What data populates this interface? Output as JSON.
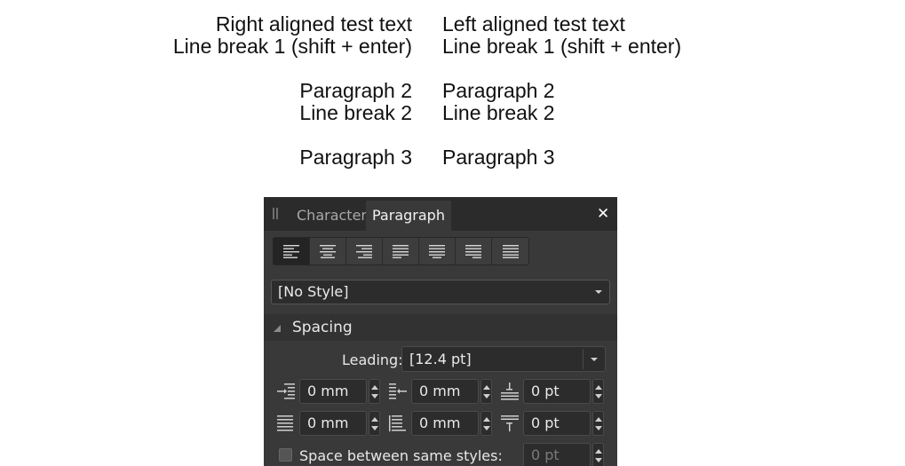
{
  "canvas": {
    "right_aligned": [
      "Right aligned test text",
      "Line break 1 (shift + enter)",
      "",
      "Paragraph 2",
      "Line break 2",
      "",
      "Paragraph 3"
    ],
    "left_aligned": [
      "Left aligned test text",
      "Line break 1 (shift + enter)",
      "",
      "Paragraph 2",
      "Line break 2",
      "",
      "Paragraph 3"
    ]
  },
  "panel": {
    "tabs": [
      "Character",
      "Paragraph"
    ],
    "active_tab": "Paragraph",
    "close_glyph": "✕",
    "alignment_buttons": [
      "align-left",
      "align-center",
      "align-right",
      "justify-left",
      "justify-center",
      "justify-right",
      "justify-all"
    ],
    "active_alignment": "align-left",
    "style_select": {
      "value": "[No Style]"
    },
    "spacing": {
      "title": "Spacing",
      "leading_label": "Leading:",
      "leading_value": "[12.4 pt]",
      "left_indent": "0 mm",
      "first_line_indent": "0 mm",
      "space_before": "0 pt",
      "right_indent": "0 mm",
      "last_line_indent": "0 mm",
      "space_after": "0 pt",
      "space_between_label": "Space between same styles:",
      "space_between_value": "0 pt"
    }
  },
  "colors": {
    "panel_bg": "#393939",
    "header_bg": "#2b2b2b",
    "field_bg": "#2c2c2c",
    "text": "#e6e6e6"
  }
}
